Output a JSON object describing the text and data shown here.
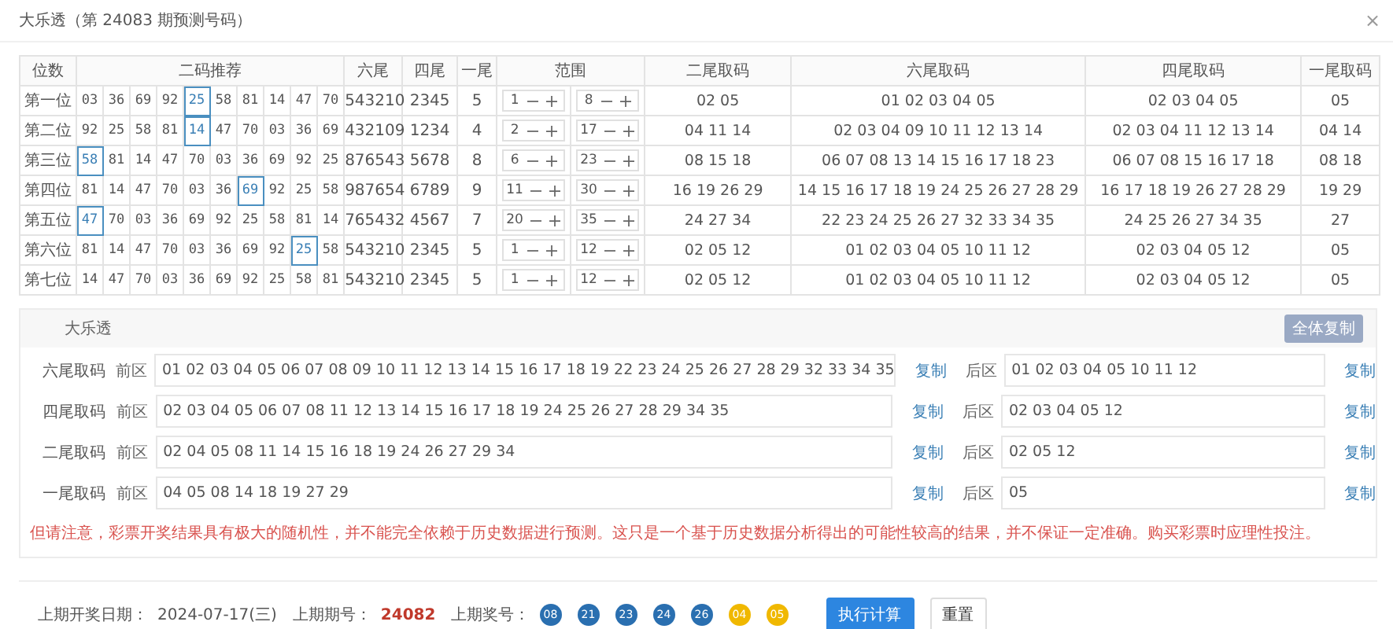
{
  "title": "大乐透（第 24083 期预测号码）",
  "close": "×",
  "table": {
    "columns": [
      "位数",
      "二码推荐",
      "六尾",
      "四尾",
      "一尾",
      "范围",
      "二尾取码",
      "六尾取码",
      "四尾取码",
      "一尾取码"
    ],
    "rows": [
      {
        "position": "第一位",
        "pairs": [
          {
            "value": "03",
            "selected": false
          },
          {
            "value": "36",
            "selected": false
          },
          {
            "value": "69",
            "selected": false
          },
          {
            "value": "92",
            "selected": false
          },
          {
            "value": "25",
            "selected": true
          },
          {
            "value": "58",
            "selected": false
          },
          {
            "value": "81",
            "selected": false
          },
          {
            "value": "14",
            "selected": false
          },
          {
            "value": "47",
            "selected": false
          },
          {
            "value": "70",
            "selected": false
          }
        ],
        "six_tail": "543210",
        "four_tail": "2345",
        "one_tail": "5",
        "range": [
          "1",
          "8"
        ],
        "two_tail_codes": "02 05",
        "six_tail_codes": "01 02 03 04 05",
        "four_tail_codes": "02 03 04 05",
        "one_tail_codes": "05"
      },
      {
        "position": "第二位",
        "pairs": [
          {
            "value": "92",
            "selected": false
          },
          {
            "value": "25",
            "selected": false
          },
          {
            "value": "58",
            "selected": false
          },
          {
            "value": "81",
            "selected": false
          },
          {
            "value": "14",
            "selected": true
          },
          {
            "value": "47",
            "selected": false
          },
          {
            "value": "70",
            "selected": false
          },
          {
            "value": "03",
            "selected": false
          },
          {
            "value": "36",
            "selected": false
          },
          {
            "value": "69",
            "selected": false
          }
        ],
        "six_tail": "432109",
        "four_tail": "1234",
        "one_tail": "4",
        "range": [
          "2",
          "17"
        ],
        "two_tail_codes": "04 11 14",
        "six_tail_codes": "02 03 04 09 10 11 12 13 14",
        "four_tail_codes": "02 03 04 11 12 13 14",
        "one_tail_codes": "04 14"
      },
      {
        "position": "第三位",
        "pairs": [
          {
            "value": "58",
            "selected": true
          },
          {
            "value": "81",
            "selected": false
          },
          {
            "value": "14",
            "selected": false
          },
          {
            "value": "47",
            "selected": false
          },
          {
            "value": "70",
            "selected": false
          },
          {
            "value": "03",
            "selected": false
          },
          {
            "value": "36",
            "selected": false
          },
          {
            "value": "69",
            "selected": false
          },
          {
            "value": "92",
            "selected": false
          },
          {
            "value": "25",
            "selected": false
          }
        ],
        "six_tail": "876543",
        "four_tail": "5678",
        "one_tail": "8",
        "range": [
          "6",
          "23"
        ],
        "two_tail_codes": "08 15 18",
        "six_tail_codes": "06 07 08 13 14 15 16 17 18 23",
        "four_tail_codes": "06 07 08 15 16 17 18",
        "one_tail_codes": "08 18"
      },
      {
        "position": "第四位",
        "pairs": [
          {
            "value": "81",
            "selected": false
          },
          {
            "value": "14",
            "selected": false
          },
          {
            "value": "47",
            "selected": false
          },
          {
            "value": "70",
            "selected": false
          },
          {
            "value": "03",
            "selected": false
          },
          {
            "value": "36",
            "selected": false
          },
          {
            "value": "69",
            "selected": true
          },
          {
            "value": "92",
            "selected": false
          },
          {
            "value": "25",
            "selected": false
          },
          {
            "value": "58",
            "selected": false
          }
        ],
        "six_tail": "987654",
        "four_tail": "6789",
        "one_tail": "9",
        "range": [
          "11",
          "30"
        ],
        "two_tail_codes": "16 19 26 29",
        "six_tail_codes": "14 15 16 17 18 19 24 25 26 27 28 29",
        "four_tail_codes": "16 17 18 19 26 27 28 29",
        "one_tail_codes": "19 29"
      },
      {
        "position": "第五位",
        "pairs": [
          {
            "value": "47",
            "selected": true
          },
          {
            "value": "70",
            "selected": false
          },
          {
            "value": "03",
            "selected": false
          },
          {
            "value": "36",
            "selected": false
          },
          {
            "value": "69",
            "selected": false
          },
          {
            "value": "92",
            "selected": false
          },
          {
            "value": "25",
            "selected": false
          },
          {
            "value": "58",
            "selected": false
          },
          {
            "value": "81",
            "selected": false
          },
          {
            "value": "14",
            "selected": false
          }
        ],
        "six_tail": "765432",
        "four_tail": "4567",
        "one_tail": "7",
        "range": [
          "20",
          "35"
        ],
        "two_tail_codes": "24 27 34",
        "six_tail_codes": "22 23 24 25 26 27 32 33 34 35",
        "four_tail_codes": "24 25 26 27 34 35",
        "one_tail_codes": "27"
      },
      {
        "position": "第六位",
        "pairs": [
          {
            "value": "81",
            "selected": false
          },
          {
            "value": "14",
            "selected": false
          },
          {
            "value": "47",
            "selected": false
          },
          {
            "value": "70",
            "selected": false
          },
          {
            "value": "03",
            "selected": false
          },
          {
            "value": "36",
            "selected": false
          },
          {
            "value": "69",
            "selected": false
          },
          {
            "value": "92",
            "selected": false
          },
          {
            "value": "25",
            "selected": true
          },
          {
            "value": "58",
            "selected": false
          }
        ],
        "six_tail": "543210",
        "four_tail": "2345",
        "one_tail": "5",
        "range": [
          "1",
          "12"
        ],
        "two_tail_codes": "02 05 12",
        "six_tail_codes": "01 02 03 04 05 10 11 12",
        "four_tail_codes": "02 03 04 05 12",
        "one_tail_codes": "05"
      },
      {
        "position": "第七位",
        "pairs": [
          {
            "value": "14",
            "selected": false
          },
          {
            "value": "47",
            "selected": false
          },
          {
            "value": "70",
            "selected": false
          },
          {
            "value": "03",
            "selected": false
          },
          {
            "value": "36",
            "selected": false
          },
          {
            "value": "69",
            "selected": false
          },
          {
            "value": "92",
            "selected": false
          },
          {
            "value": "25",
            "selected": false
          },
          {
            "value": "58",
            "selected": false
          },
          {
            "value": "81",
            "selected": false
          }
        ],
        "six_tail": "543210",
        "four_tail": "2345",
        "one_tail": "5",
        "range": [
          "1",
          "12"
        ],
        "two_tail_codes": "02 05 12",
        "six_tail_codes": "01 02 03 04 05 10 11 12",
        "four_tail_codes": "02 03 04 05 12",
        "one_tail_codes": "05"
      }
    ]
  },
  "codes_section": {
    "title": "大乐透",
    "copy_all": "全体复制",
    "rows": [
      {
        "label": "六尾取码",
        "front_label": "前区",
        "front": "01 02 03 04 05 06 07 08 09 10 11 12 13 14 15 16 17 18 19 22 23 24 25 26 27 28 29 32 33 34 35",
        "front_copy": "复制",
        "back_label": "后区",
        "back": "01 02 03 04 05 10 11 12",
        "back_copy": "复制"
      },
      {
        "label": "四尾取码",
        "front_label": "前区",
        "front": "02 03 04 05 06 07 08 11 12 13 14 15 16 17 18 19 24 25 26 27 28 29 34 35",
        "front_copy": "复制",
        "back_label": "后区",
        "back": "02 03 04 05 12",
        "back_copy": "复制"
      },
      {
        "label": "二尾取码",
        "front_label": "前区",
        "front": "02 04 05 08 11 14 15 16 18 19 24 26 27 29 34",
        "front_copy": "复制",
        "back_label": "后区",
        "back": "02 05 12",
        "back_copy": "复制"
      },
      {
        "label": "一尾取码",
        "front_label": "前区",
        "front": "04 05 08 14 18 19 27 29",
        "front_copy": "复制",
        "back_label": "后区",
        "back": "05",
        "back_copy": "复制"
      }
    ],
    "notice": "但请注意，彩票开奖结果具有极大的随机性，并不能完全依赖于历史数据进行预测。这只是一个基于历史数据分析得出的可能性较高的结果，并不保证一定准确。购买彩票时应理性投注。"
  },
  "footer": {
    "date_label": "上期开奖日期：",
    "date": "2024-07-17(三)",
    "issue_label": "上期期号：",
    "issue": "24082",
    "numbers_label": "上期奖号：",
    "balls": [
      {
        "number": "08",
        "kind": "front"
      },
      {
        "number": "21",
        "kind": "front"
      },
      {
        "number": "23",
        "kind": "front"
      },
      {
        "number": "24",
        "kind": "front"
      },
      {
        "number": "26",
        "kind": "front"
      },
      {
        "number": "04",
        "kind": "back"
      },
      {
        "number": "05",
        "kind": "back"
      }
    ],
    "buttons": [
      {
        "label": "执行计算",
        "kind": "primary"
      },
      {
        "label": "重置",
        "kind": "default"
      }
    ]
  }
}
